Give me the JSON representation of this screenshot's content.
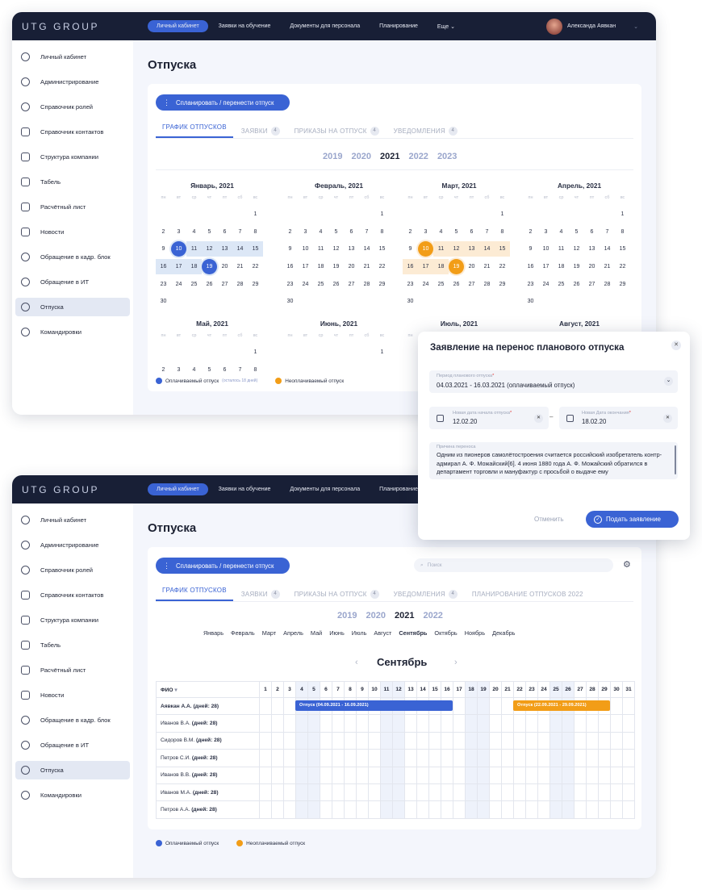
{
  "app": {
    "logo": "UTG GROUP",
    "nav": [
      "Личный кабинет",
      "Заявки на обучение",
      "Документы для персонала",
      "Планирование",
      "Еще"
    ],
    "user_name": "Александа Аявкан",
    "sidebar": [
      "Личный кабинет",
      "Администрирование",
      "Справочник ролей",
      "Справочник контактов",
      "Структура компании",
      "Табель",
      "Расчётный лист",
      "Новости",
      "Обращение в кадр. блок",
      "Обращение в ИТ",
      "Отпуска",
      "Командировки"
    ]
  },
  "page_title": "Отпуска",
  "plan_button": "Спланировать / перенести отпуск",
  "tabs": {
    "schedule": "ГРАФИК ОТПУСКОВ",
    "requests": "ЗАЯВКИ",
    "requests_count": "4",
    "orders": "ПРИКАЗЫ НА ОТПУСК",
    "orders_count": "4",
    "notifications": "УВЕДОМЛЕНИЯ",
    "notifications_count": "4",
    "planning": "ПЛАНИРОВАНИЕ ОТПУСКОВ 2022"
  },
  "years_top": [
    "2019",
    "2020",
    "2021",
    "2022",
    "2023"
  ],
  "years_bottom": [
    "2019",
    "2020",
    "2021",
    "2022"
  ],
  "selected_year": "2021",
  "weekdays": [
    "пн",
    "вт",
    "ср",
    "чт",
    "пт",
    "сб",
    "вс"
  ],
  "calendar": [
    {
      "name": "Январь, 2021",
      "offset": 6,
      "days": 30
    },
    {
      "name": "Февраль, 2021",
      "offset": 6,
      "days": 30
    },
    {
      "name": "Март, 2021",
      "offset": 6,
      "days": 30
    },
    {
      "name": "Апрель, 2021",
      "offset": 6,
      "days": 30
    },
    {
      "name": "Май, 2021",
      "offset": 6,
      "days": 8
    },
    {
      "name": "Июнь, 2021",
      "offset": 6,
      "days": 1
    },
    {
      "name": "Июль, 2021",
      "offset": 6,
      "days": 0
    },
    {
      "name": "Август, 2021",
      "offset": 6,
      "days": 0
    }
  ],
  "highlights": {
    "january": {
      "from": 10,
      "to": 19,
      "color": "#3a63d4"
    },
    "march": {
      "from": 10,
      "to": 19,
      "color": "#f29d17"
    }
  },
  "legend": {
    "paid": "Оплачиваемый отпуск",
    "paid_remaining": "(осталось 18 дней)",
    "unpaid": "Неоплачиваемый отпуск",
    "paid_color": "#3a63d4",
    "unpaid_color": "#f29d17"
  },
  "modal": {
    "title": "Заявление на перенос планового отпуска",
    "period_label": "Период планового отпуска",
    "period_value": "04.03.2021 - 16.03.2021 (оплачиваемый отпуск)",
    "start_label": "Новая дата начала отпуска",
    "start_value": "12.02.20",
    "end_label": "Новая Дата окончания",
    "end_value": "18.02.20",
    "reason_label": "Причина переноса",
    "reason_text": "Одним из пионеров самолётостроения считается российский изобретатель контр-адмирал А. Ф. Можайский[6]. 4 июня 1880 года А. Ф. Можайский обратился в департамент торговли и мануфактур с просьбой о выдаче ему",
    "cancel": "Отменить",
    "submit": "Подать заявление"
  },
  "search_placeholder": "Поиск",
  "months": [
    "Январь",
    "Февраль",
    "Март",
    "Апрель",
    "Май",
    "Июнь",
    "Июль",
    "Август",
    "Сентябрь",
    "Октябрь",
    "Ноябрь",
    "Декабрь"
  ],
  "selected_month": "Сентябрь",
  "gantt": {
    "name_header": "ФИО",
    "days": 31,
    "weekends": [
      4,
      5,
      11,
      12,
      18,
      19,
      25,
      26
    ],
    "rows": [
      {
        "name": "Аявкан А.А.",
        "days": "(дней: 28)"
      },
      {
        "name": "Иванов В.А.",
        "days": "(дней: 28)"
      },
      {
        "name": "Сидоров В.М.",
        "days": "(дней: 28)"
      },
      {
        "name": "Петров С.И.",
        "days": "(дней: 28)"
      },
      {
        "name": "Иванов В.В.",
        "days": "(дней: 28)"
      },
      {
        "name": "Иванов М.А.",
        "days": "(дней: 28)"
      },
      {
        "name": "Петров А.А.",
        "days": "(дней: 28)"
      }
    ],
    "bars": [
      {
        "label": "Отпуск (04.09.2021 - 16.09.2021)",
        "from": 4,
        "to": 16,
        "color": "#3a63d4"
      },
      {
        "label": "Отпуск (22.09.2021 - 29.09.2021)",
        "from": 22,
        "to": 29,
        "color": "#f29d17"
      }
    ]
  }
}
